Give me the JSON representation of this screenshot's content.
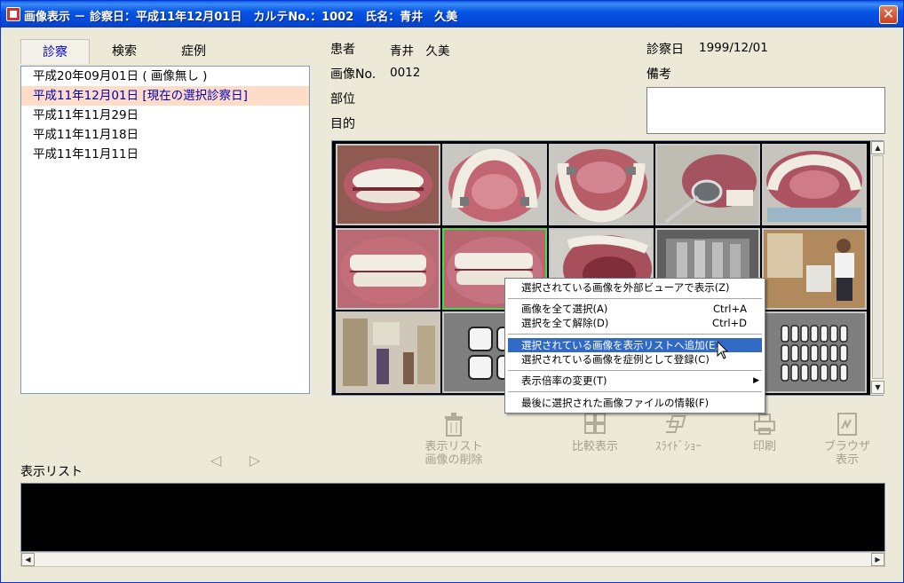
{
  "window": {
    "title": "画像表示 － 診察日：平成11年12月01日　カルテNo.：1002　氏名：青井　久美",
    "close_glyph": "✕"
  },
  "tabs": [
    {
      "label": "診察",
      "active": true
    },
    {
      "label": "検索",
      "active": false
    },
    {
      "label": "症例",
      "active": false
    }
  ],
  "dates": [
    {
      "label": "平成20年09月01日 ( 画像無し )",
      "selected": false
    },
    {
      "label": "平成11年12月01日 [現在の選択診察日]",
      "selected": true
    },
    {
      "label": "平成11年11月29日",
      "selected": false
    },
    {
      "label": "平成11年11月18日",
      "selected": false
    },
    {
      "label": "平成11年11月11日",
      "selected": false
    }
  ],
  "info": {
    "patient_label": "患者",
    "patient_value": "青井　久美",
    "image_no_label": "画像No.",
    "image_no_value": "0012",
    "region_label": "部位",
    "purpose_label": "目的",
    "date_label": "診察日",
    "date_value": "1999/12/01",
    "memo_label": "備考"
  },
  "thumbnails": [
    {
      "name": "front-smile-photo",
      "kind": "photo",
      "selected": false
    },
    {
      "name": "upper-arch-photo",
      "kind": "photo",
      "selected": false
    },
    {
      "name": "lower-arch-photo",
      "kind": "photo",
      "selected": false
    },
    {
      "name": "mirror-instrument-photo",
      "kind": "photo",
      "selected": false
    },
    {
      "name": "upper-arch-wide-photo",
      "kind": "photo",
      "selected": false
    },
    {
      "name": "right-side-bite-photo",
      "kind": "photo",
      "selected": false
    },
    {
      "name": "left-side-bite-photo",
      "kind": "photo",
      "selected": true
    },
    {
      "name": "open-mouth-photo",
      "kind": "photo",
      "selected": false
    },
    {
      "name": "xray-photo",
      "kind": "photo",
      "selected": false
    },
    {
      "name": "clinic-patient-photo",
      "kind": "photo",
      "selected": false
    },
    {
      "name": "shop-interior-photo",
      "kind": "photo",
      "selected": false
    },
    {
      "name": "layout-4-icon",
      "kind": "layout4",
      "selected": false
    },
    {
      "name": "empty-slot",
      "kind": "empty",
      "selected": false
    },
    {
      "name": "empty-slot",
      "kind": "empty",
      "selected": false
    },
    {
      "name": "layout-21-icon",
      "kind": "layout21",
      "selected": false
    }
  ],
  "toolbar": {
    "delete_label_1": "表示リスト",
    "delete_label_2": "画像の削除",
    "compare_label": "比較表示",
    "slideshow_label": "ｽﾗｲﾄﾞｼｮｰ",
    "print_label": "印刷",
    "browser_label_1": "ブラウザ",
    "browser_label_2": "表示",
    "prev_glyph": "◁",
    "next_glyph": "▷"
  },
  "display_list_title": "表示リスト",
  "context_menu": {
    "items": [
      {
        "label": "選択されている画像を外部ビューアで表示(Z)",
        "shortcut": "",
        "highlight": false,
        "submenu": false
      },
      {
        "label": "画像を全て選択(A)",
        "shortcut": "Ctrl+A",
        "highlight": false,
        "submenu": false
      },
      {
        "label": "選択を全て解除(D)",
        "shortcut": "Ctrl+D",
        "highlight": false,
        "submenu": false
      },
      {
        "label": "選択されている画像を表示リストへ追加(E)",
        "shortcut": "",
        "highlight": true,
        "submenu": false
      },
      {
        "label": "選択されている画像を症例として登録(C)",
        "shortcut": "",
        "highlight": false,
        "submenu": false
      },
      {
        "label": "表示倍率の変更(T)",
        "shortcut": "",
        "highlight": false,
        "submenu": true
      },
      {
        "label": "最後に選択された画像ファイルの情報(F)",
        "shortcut": "",
        "highlight": false,
        "submenu": false
      }
    ]
  },
  "scroll": {
    "up": "▲",
    "down": "▼",
    "left": "◀",
    "right": "▶"
  }
}
